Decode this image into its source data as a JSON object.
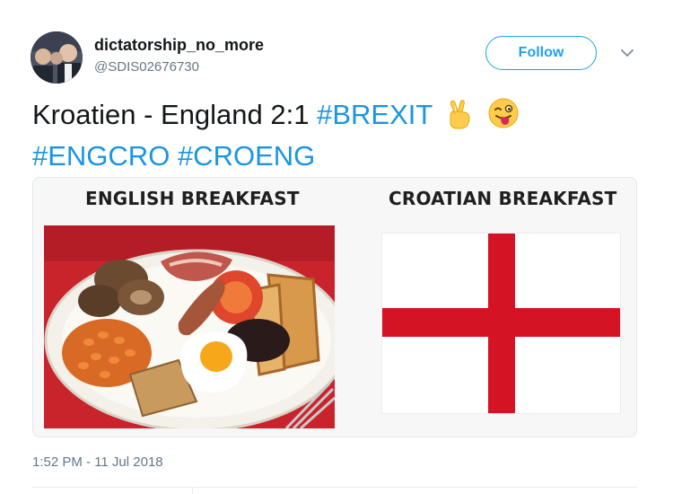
{
  "tweet": {
    "display_name": "dictatorship_no_more",
    "handle": "@SDIS02676730",
    "follow_label": "Follow",
    "text_plain": "Kroatien - England 2:1 ",
    "hashtags": [
      "#BREXIT",
      "#ENGCRO",
      "#CROENG"
    ],
    "emojis": [
      "victory-hand",
      "winking-face-with-tongue"
    ],
    "timestamp": "1:52 PM - 11 Jul 2018"
  },
  "card": {
    "left_label": "ENGLISH BREAKFAST",
    "right_label": "CROATIAN BREAKFAST",
    "left_image": "english-breakfast-plate",
    "right_image": "england-flag-st-george-cross"
  },
  "colors": {
    "link": "#1b95e0",
    "follow": "#1da1f2",
    "secondary_text": "#657786",
    "flag_red": "#d41424"
  }
}
